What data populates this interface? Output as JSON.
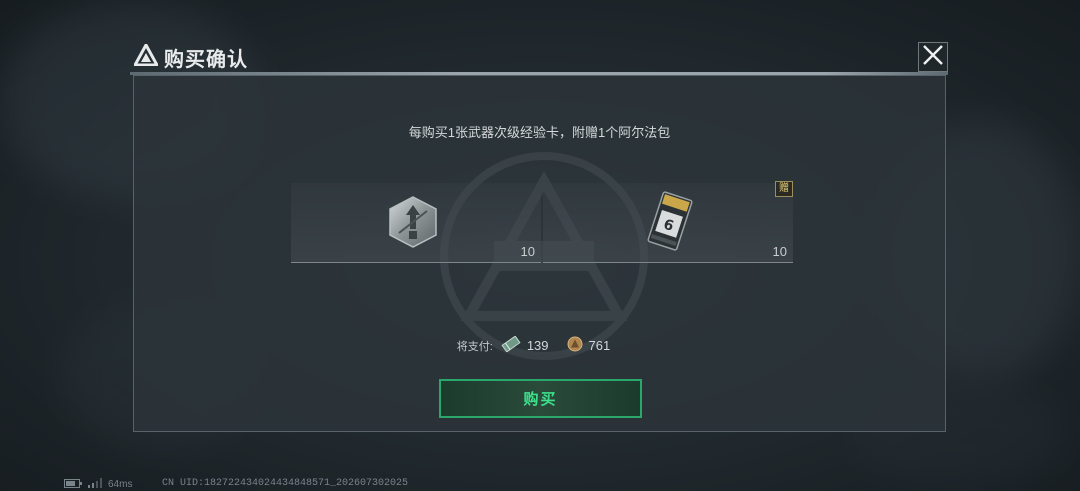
{
  "dialog": {
    "title": "购买确认",
    "subtitle": "每购买1张武器次级经验卡，附赠1个阿尔法包"
  },
  "items": [
    {
      "name": "weapon-xp-card",
      "count": "10",
      "gift": false
    },
    {
      "name": "alpha-pack",
      "count": "10",
      "gift": true,
      "gift_label": "赠"
    }
  ],
  "payment": {
    "label": "将支付:",
    "currency_1": {
      "icon": "ticket-icon",
      "value": "139"
    },
    "currency_2": {
      "icon": "coin-icon",
      "value": "761"
    }
  },
  "buy_button": {
    "label": "购买"
  },
  "status": {
    "ping": "64ms",
    "uid": "CN UID:182722434024434848571_202607302025"
  },
  "colors": {
    "accent_green": "#3ee08c",
    "button_border": "#2aa86c",
    "gift_gold": "#e2cc7a"
  }
}
